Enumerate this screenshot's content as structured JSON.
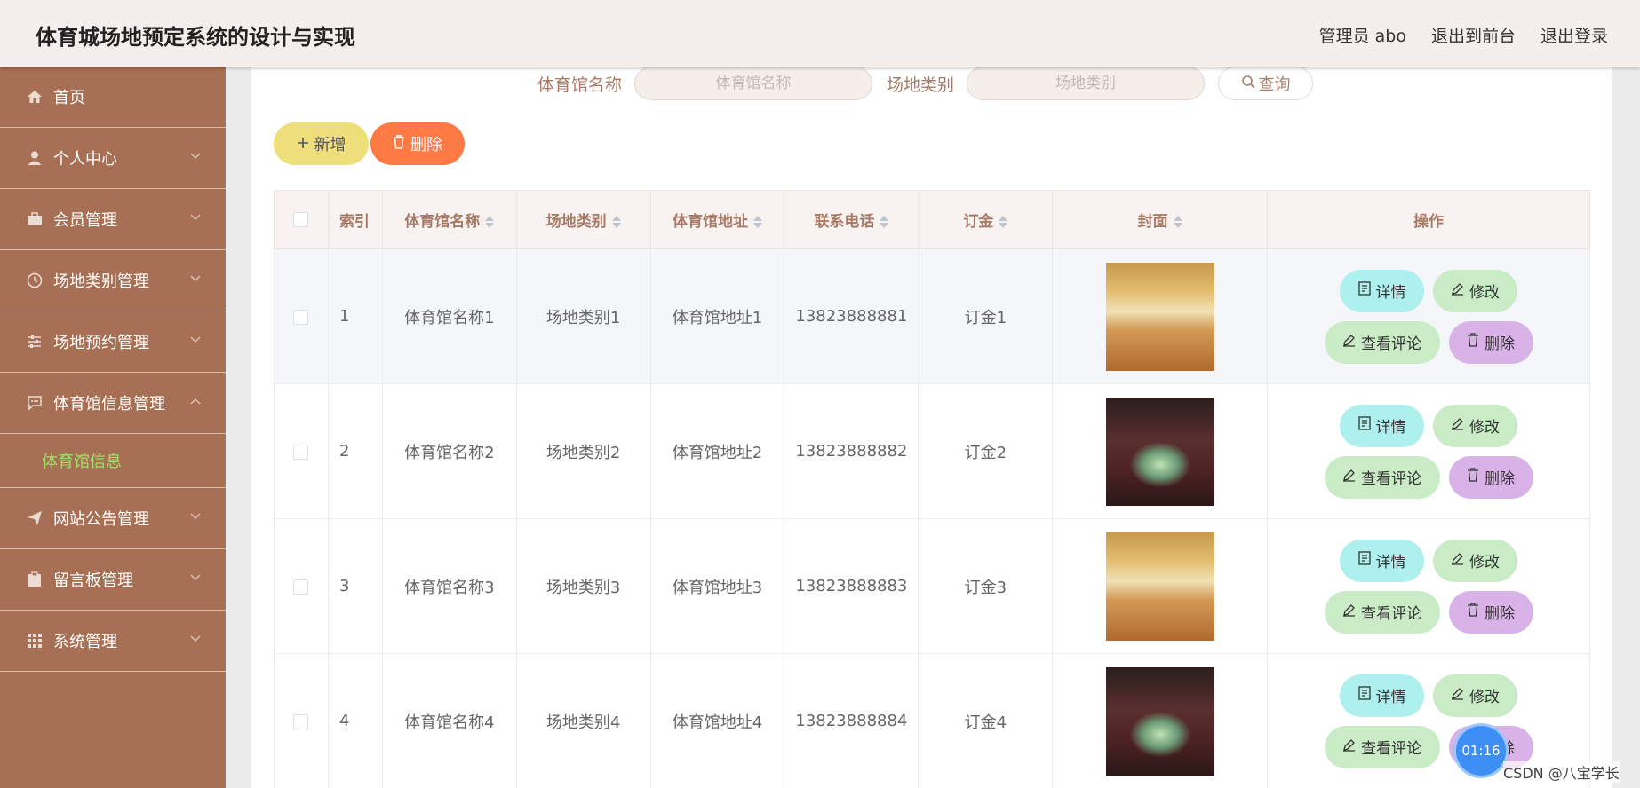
{
  "header": {
    "title": "体育城场地预定系统的设计与实现",
    "admin": "管理员 abo",
    "to_front": "退出到前台",
    "logout": "退出登录"
  },
  "sidebar": {
    "items": [
      {
        "label": "首页",
        "icon": "home-icon"
      },
      {
        "label": "个人中心",
        "icon": "user-icon"
      },
      {
        "label": "会员管理",
        "icon": "briefcase-icon"
      },
      {
        "label": "场地类别管理",
        "icon": "clock-icon"
      },
      {
        "label": "场地预约管理",
        "icon": "sliders-icon"
      },
      {
        "label": "体育馆信息管理",
        "icon": "chat-icon",
        "expanded": true
      },
      {
        "label": "网站公告管理",
        "icon": "send-icon"
      },
      {
        "label": "留言板管理",
        "icon": "clipboard-icon"
      },
      {
        "label": "系统管理",
        "icon": "grid-icon"
      }
    ],
    "sub_active": "体育馆信息"
  },
  "search": {
    "name_label": "体育馆名称",
    "name_placeholder": "体育馆名称",
    "type_label": "场地类别",
    "type_placeholder": "场地类别",
    "query_label": "查询"
  },
  "toolbar": {
    "add_label": "新增",
    "delete_label": "删除"
  },
  "table": {
    "headers": [
      "索引",
      "体育馆名称",
      "场地类别",
      "体育馆地址",
      "联系电话",
      "订金",
      "封面",
      "操作"
    ],
    "rows": [
      {
        "index": "1",
        "name": "体育馆名称1",
        "type": "场地类别1",
        "address": "体育馆地址1",
        "phone": "13823888881",
        "deposit": "订金1",
        "cover": "gym"
      },
      {
        "index": "2",
        "name": "体育馆名称2",
        "type": "场地类别2",
        "address": "体育馆地址2",
        "phone": "13823888882",
        "deposit": "订金2",
        "cover": "arena"
      },
      {
        "index": "3",
        "name": "体育馆名称3",
        "type": "场地类别3",
        "address": "体育馆地址3",
        "phone": "13823888883",
        "deposit": "订金3",
        "cover": "gym"
      },
      {
        "index": "4",
        "name": "体育馆名称4",
        "type": "场地类别4",
        "address": "体育馆地址4",
        "phone": "13823888884",
        "deposit": "订金4",
        "cover": "arena"
      }
    ],
    "actions": {
      "detail": "详情",
      "edit": "修改",
      "review": "查看评论",
      "delete": "删除"
    }
  },
  "overlay": {
    "timer": "01:16",
    "watermark": "CSDN @八宝学长"
  },
  "colors": {
    "sidebar": "#a76f53",
    "active_sub": "#a5e16a",
    "add_button": "#eedf7a",
    "delete_button": "#fd7a45"
  }
}
